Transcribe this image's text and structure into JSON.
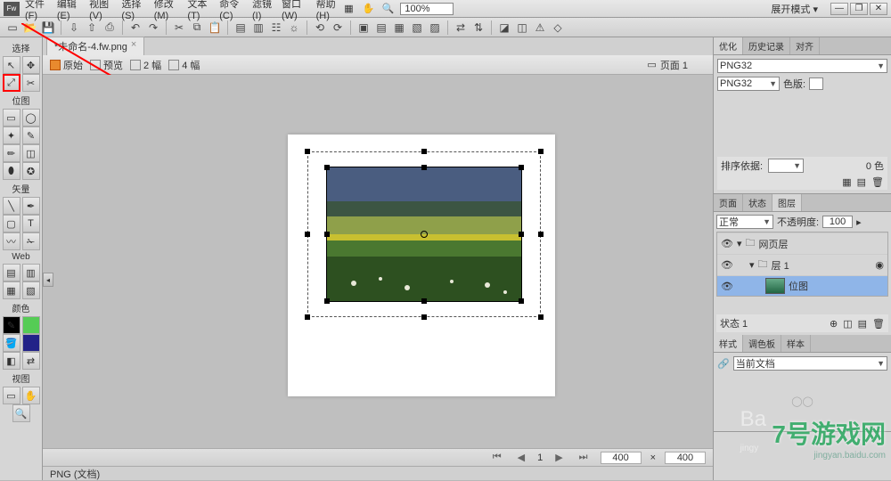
{
  "menu": [
    "文件(F)",
    "编辑(E)",
    "视图(V)",
    "选择(S)",
    "修改(M)",
    "文本(T)",
    "命令(C)",
    "滤镜(I)",
    "窗口(W)",
    "帮助(H)"
  ],
  "zoom": "100%",
  "expand_label": "展开模式 ▾",
  "doc_tab": "*未命名-4.fw.png",
  "opt": {
    "original": "原始",
    "preview": "预览",
    "two": "2 幅",
    "four": "4 幅",
    "page": "页面 1"
  },
  "right": {
    "tabs1": [
      "优化",
      "历史记录",
      "对齐"
    ],
    "png_opt": "PNG32",
    "png_opt2": "PNG32",
    "color_label": "色版:",
    "sort_label": "排序依据:",
    "color_count": "0 色",
    "tabs2": [
      "页面",
      "状态",
      "图层"
    ],
    "blend": "正常",
    "opacity_label": "不透明度:",
    "opacity_val": "100",
    "layers": [
      {
        "name": "网页层",
        "indent": 0,
        "sel": false,
        "folder": true
      },
      {
        "name": "层 1",
        "indent": 1,
        "sel": false,
        "folder": true
      },
      {
        "name": "位图",
        "indent": 2,
        "sel": true,
        "folder": false
      }
    ],
    "status_label": "状态 1",
    "tabs3": [
      "样式",
      "调色板",
      "样本"
    ],
    "current_doc": "当前文档"
  },
  "left_groups": [
    "选择",
    "位图",
    "矢量",
    "Web",
    "颜色",
    "视图"
  ],
  "canvas": {
    "page_num": "1",
    "dim_w": "400",
    "dim_h": "400"
  },
  "statusbar": "PNG (文档)",
  "watermark": {
    "big": "7号游戏网",
    "url": "jingyan.baidu.com"
  }
}
